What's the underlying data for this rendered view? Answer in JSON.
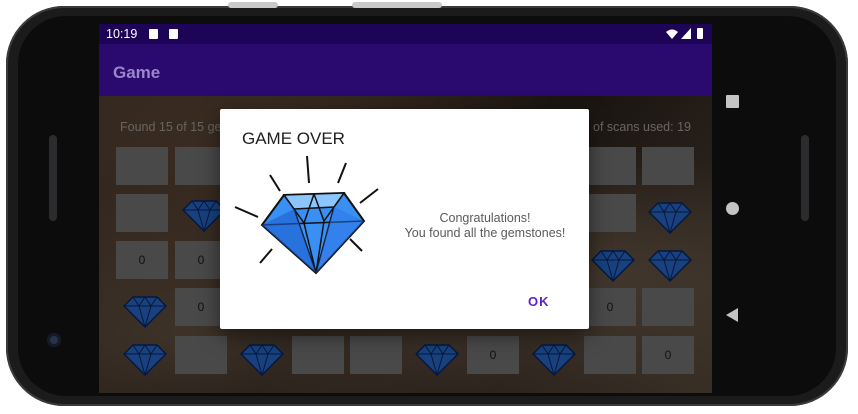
{
  "status_bar": {
    "time": "10:19"
  },
  "app_bar": {
    "title": "Game"
  },
  "game": {
    "found_text": "Found 15 of 15 ge",
    "scans_text": "of scans used: 19",
    "visible_cell_numbers": [
      "0",
      "0",
      "0",
      "0",
      "0",
      "0"
    ]
  },
  "dialog": {
    "title": "GAME OVER",
    "message_line1": "Congratulations!",
    "message_line2": "You found all the gemstones!",
    "ok_label": "OK"
  },
  "icons": {
    "gem": "diamond-icon",
    "nav_recents": "square-icon",
    "nav_home": "circle-icon",
    "nav_back": "triangle-back-icon"
  },
  "colors": {
    "status_bar": "#1d0457",
    "app_bar": "#2a0a6e",
    "accent": "#5a1fd1",
    "gem_blue": "#2f7df0"
  }
}
